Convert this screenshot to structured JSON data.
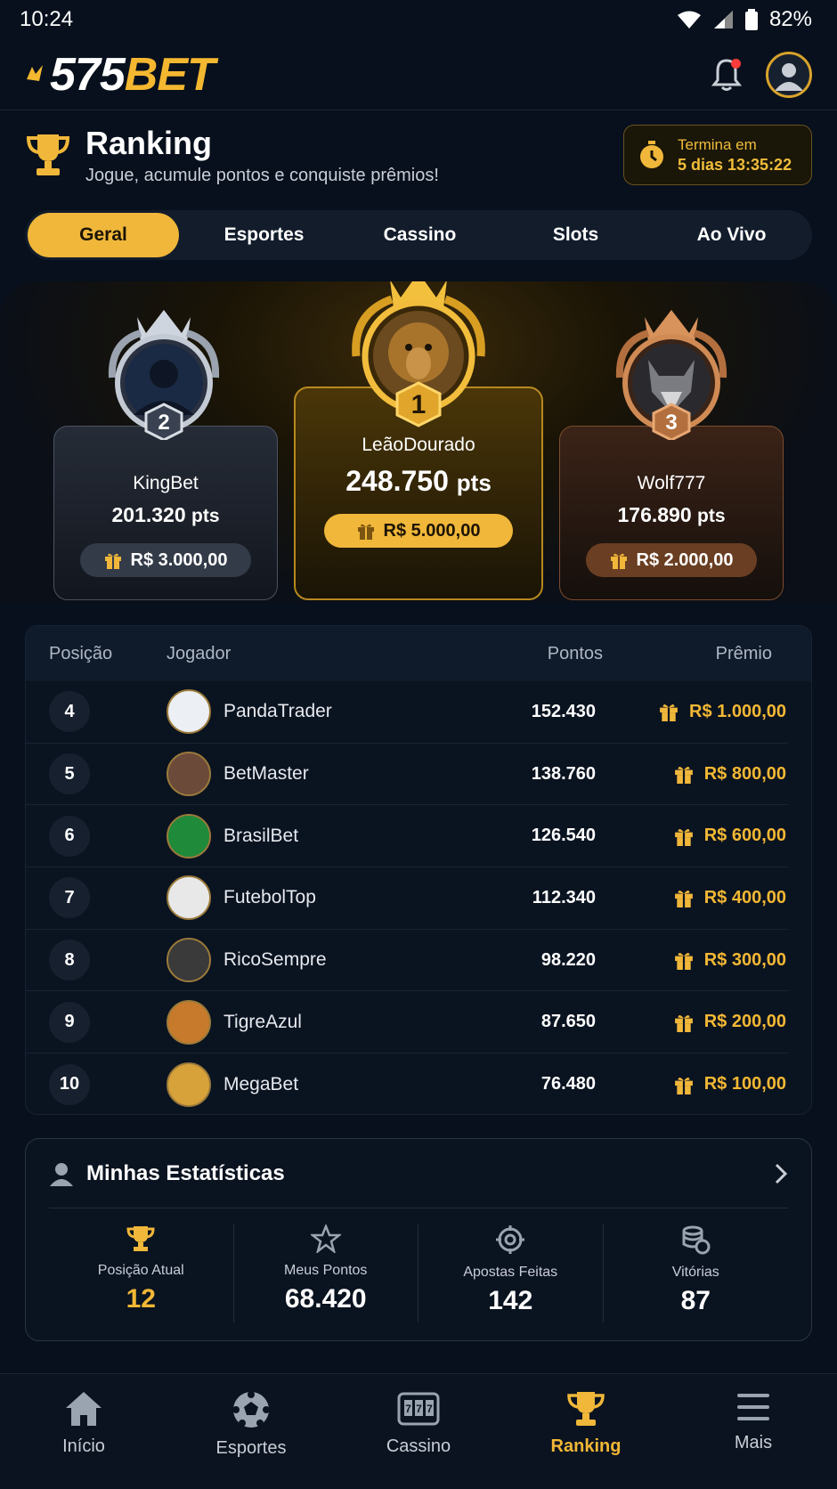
{
  "status": {
    "time": "10:24",
    "battery": "82%"
  },
  "header": {
    "logo_main": "575",
    "logo_accent": "BET"
  },
  "page": {
    "title": "Ranking",
    "subtitle": "Jogue, acumule pontos e conquiste prêmios!",
    "timer_label": "Termina em",
    "timer_value": "5 dias 13:35:22"
  },
  "tabs": [
    "Geral",
    "Esportes",
    "Cassino",
    "Slots",
    "Ao Vivo"
  ],
  "podium": {
    "first": {
      "rank": "1",
      "name": "LeãoDourado",
      "points": "248.750",
      "unit": "pts",
      "prize": "R$ 5.000,00"
    },
    "second": {
      "rank": "2",
      "name": "KingBet",
      "points": "201.320",
      "unit": "pts",
      "prize": "R$ 3.000,00"
    },
    "third": {
      "rank": "3",
      "name": "Wolf777",
      "points": "176.890",
      "unit": "pts",
      "prize": "R$ 2.000,00"
    }
  },
  "table": {
    "headers": {
      "position": "Posição",
      "player": "Jogador",
      "points": "Pontos",
      "prize": "Prêmio"
    },
    "rows": [
      {
        "rank": "4",
        "name": "PandaTrader",
        "points": "152.430",
        "prize": "R$ 1.000,00"
      },
      {
        "rank": "5",
        "name": "BetMaster",
        "points": "138.760",
        "prize": "R$ 800,00"
      },
      {
        "rank": "6",
        "name": "BrasilBet",
        "points": "126.540",
        "prize": "R$ 600,00"
      },
      {
        "rank": "7",
        "name": "FutebolTop",
        "points": "112.340",
        "prize": "R$ 400,00"
      },
      {
        "rank": "8",
        "name": "RicoSempre",
        "points": "98.220",
        "prize": "R$ 300,00"
      },
      {
        "rank": "9",
        "name": "TigreAzul",
        "points": "87.650",
        "prize": "R$ 200,00"
      },
      {
        "rank": "10",
        "name": "MegaBet",
        "points": "76.480",
        "prize": "R$ 100,00"
      }
    ]
  },
  "stats": {
    "title": "Minhas Estatísticas",
    "items": [
      {
        "label": "Posição Atual",
        "value": "12"
      },
      {
        "label": "Meus Pontos",
        "value": "68.420"
      },
      {
        "label": "Apostas Feitas",
        "value": "142"
      },
      {
        "label": "Vitórias",
        "value": "87"
      }
    ]
  },
  "nav": [
    "Início",
    "Esportes",
    "Cassino",
    "Ranking",
    "Mais"
  ],
  "colors": {
    "accent": "#f0b73a",
    "background": "#07101c",
    "silver": "#b9c0cc",
    "bronze": "#c9834e"
  }
}
